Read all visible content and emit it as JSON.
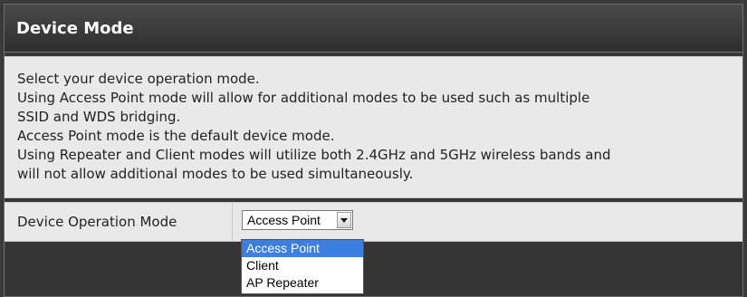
{
  "section": {
    "title": "Device Mode"
  },
  "description": {
    "lines": [
      "Select your device operation mode.",
      "Using Access Point mode will allow for additional modes to be used such as multiple",
      "SSID and WDS bridging.",
      "Access Point mode is the default device mode.",
      "Using Repeater and Client modes will utilize both 2.4GHz and 5GHz wireless bands and",
      "will not allow additional modes to be used simultaneously."
    ]
  },
  "operation_mode": {
    "label": "Device Operation Mode",
    "selected_value": "Access Point",
    "options": [
      "Access Point",
      "Client",
      "AP Repeater"
    ],
    "highlighted_index": 0
  },
  "colors": {
    "title_bg": "#3a3a3a",
    "content_bg": "#e9e9e9",
    "option_highlight": "#3b7fe0"
  },
  "icons": {
    "dropdown_arrow": "chevron-down-icon"
  }
}
